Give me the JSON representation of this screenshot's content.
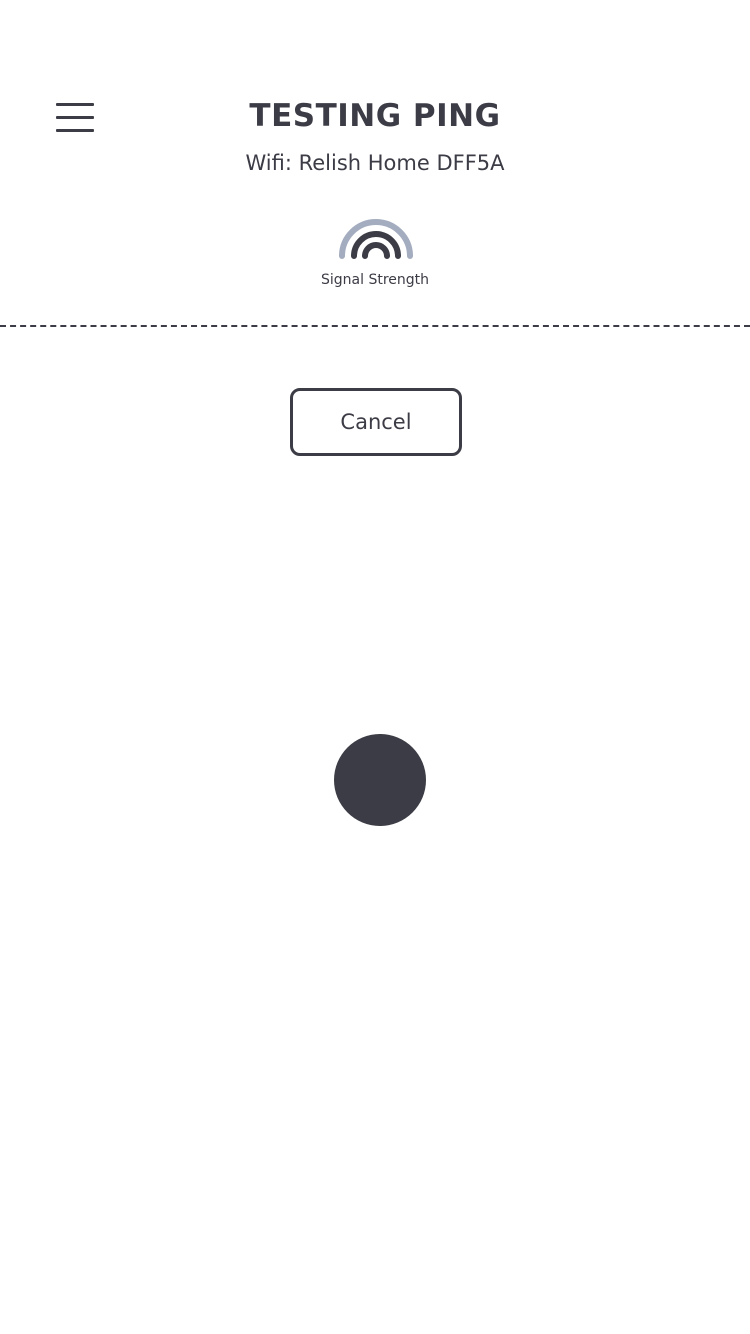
{
  "header": {
    "menu_icon": "hamburger-menu-icon",
    "title": "TESTING PING",
    "wifi_label": "Wifi: Relish Home DFF5A"
  },
  "signal": {
    "icon": "wifi-signal-icon",
    "label": "Signal Strength",
    "bars_total": 3,
    "bars_active": 2,
    "active_color": "#3c3c46",
    "inactive_color": "#a4adbf"
  },
  "actions": {
    "cancel_label": "Cancel"
  },
  "loading": {
    "icon": "loading-dot-icon",
    "color": "#3c3c46"
  }
}
